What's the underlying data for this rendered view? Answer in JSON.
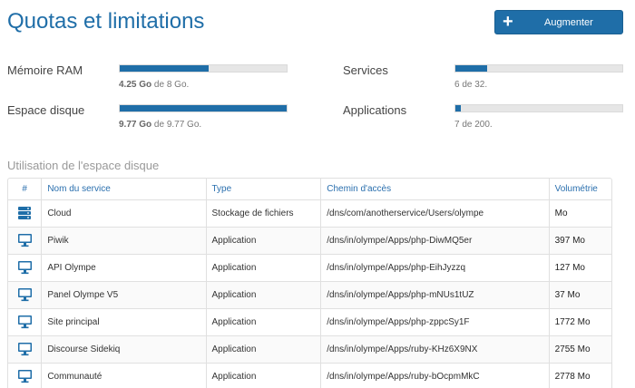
{
  "header": {
    "title": "Quotas et limitations",
    "button_label": "Augmenter",
    "button_icon": "plus-icon"
  },
  "quotas": {
    "ram": {
      "label": "Mémoire RAM",
      "used": "4.25 Go",
      "rest": " de 8 Go.",
      "fraction": 0.53
    },
    "disk": {
      "label": "Espace disque",
      "used": "9.77 Go",
      "rest": " de 9.77 Go.",
      "fraction": 1.0
    },
    "services": {
      "label": "Services",
      "text": "6 de 32.",
      "fraction": 0.19
    },
    "apps": {
      "label": "Applications",
      "text": "7 de 200.",
      "fraction": 0.035
    }
  },
  "disk_usage": {
    "title": "Utilisation de l'espace disque",
    "columns": [
      "#",
      "Nom du service",
      "Type",
      "Chemin d'accès",
      "Volumétrie"
    ],
    "rows": [
      {
        "icon": "server-icon",
        "name": "Cloud",
        "type": "Stockage de fichiers",
        "path": "/dns/com/anotherservice/Users/olympe",
        "volume": "Mo"
      },
      {
        "icon": "monitor-icon",
        "name": "Piwik",
        "type": "Application",
        "path": "/dns/in/olympe/Apps/php-DiwMQ5er",
        "volume": "397 Mo"
      },
      {
        "icon": "monitor-icon",
        "name": "API Olympe",
        "type": "Application",
        "path": "/dns/in/olympe/Apps/php-EihJyzzq",
        "volume": "127 Mo"
      },
      {
        "icon": "monitor-icon",
        "name": "Panel Olympe V5",
        "type": "Application",
        "path": "/dns/in/olympe/Apps/php-mNUs1tUZ",
        "volume": "37 Mo"
      },
      {
        "icon": "monitor-icon",
        "name": "Site principal",
        "type": "Application",
        "path": "/dns/in/olympe/Apps/php-zppcSy1F",
        "volume": "1772 Mo"
      },
      {
        "icon": "monitor-icon",
        "name": "Discourse Sidekiq",
        "type": "Application",
        "path": "/dns/in/olympe/Apps/ruby-KHz6X9NX",
        "volume": "2755 Mo"
      },
      {
        "icon": "monitor-icon",
        "name": "Communauté",
        "type": "Application",
        "path": "/dns/in/olympe/Apps/ruby-bOcpmMkC",
        "volume": "2778 Mo"
      }
    ]
  },
  "colors": {
    "accent": "#1f6ea8",
    "bar_track": "#e6e6e6"
  }
}
